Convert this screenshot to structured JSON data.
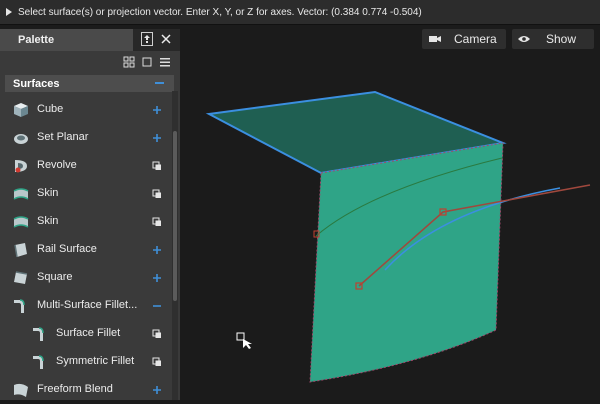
{
  "prompt": {
    "text": "Select surface(s) or projection vector.  Enter X, Y, or Z for axes.  Vector: (0.384 0.774 -0.504)"
  },
  "palette": {
    "title": "Palette",
    "section": "Surfaces",
    "items": [
      {
        "label": "Cube",
        "icon": "cube-icon",
        "action": "add"
      },
      {
        "label": "Set Planar",
        "icon": "set-planar-icon",
        "action": "add"
      },
      {
        "label": "Revolve",
        "icon": "revolve-icon",
        "action": "options"
      },
      {
        "label": "Skin",
        "icon": "skin-icon",
        "action": "options"
      },
      {
        "label": "Skin",
        "icon": "skin-icon",
        "action": "options"
      },
      {
        "label": "Rail Surface",
        "icon": "rail-surface-icon",
        "action": "add"
      },
      {
        "label": "Square",
        "icon": "square-surface-icon",
        "action": "add"
      },
      {
        "label": "Multi-Surface Fillet...",
        "icon": "multi-surface-fillet-icon",
        "action": "collapse"
      },
      {
        "label": "Surface Fillet",
        "icon": "surface-fillet-icon",
        "action": "options"
      },
      {
        "label": "Symmetric Fillet",
        "icon": "symmetric-fillet-icon",
        "action": "options"
      },
      {
        "label": "Freeform Blend",
        "icon": "freeform-blend-icon",
        "action": "add"
      }
    ]
  },
  "viewport": {
    "camera_label": "Camera",
    "show_label": "Show"
  },
  "colors": {
    "accent_blue": "#3f8fd8",
    "surface_teal": "#2fa487",
    "surface_top": "#1f5f52",
    "edge_blue": "#3b8fe0",
    "curve_red": "#a0483d"
  }
}
